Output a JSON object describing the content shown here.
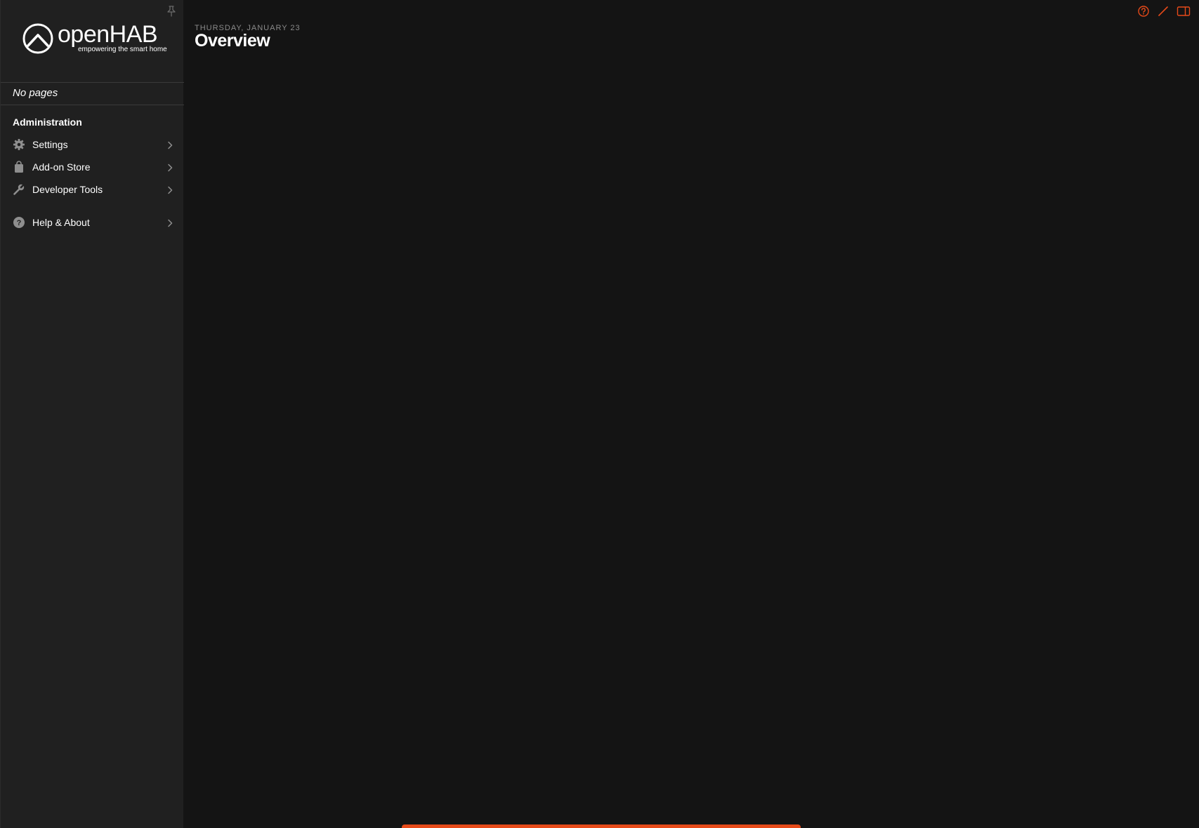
{
  "app": {
    "logo_text": "openHAB",
    "logo_tagline": "empowering the smart home"
  },
  "sidebar": {
    "no_pages_text": "No pages",
    "section_title": "Administration",
    "items": [
      {
        "label": "Settings",
        "icon": "gear-icon"
      },
      {
        "label": "Add-on Store",
        "icon": "bag-icon"
      },
      {
        "label": "Developer Tools",
        "icon": "wrench-icon"
      },
      {
        "label": "Help & About",
        "icon": "help-circle-icon"
      }
    ]
  },
  "header": {
    "date": "THURSDAY, JANUARY 23",
    "title": "Overview"
  },
  "toolbar": {
    "icons": [
      "help-icon",
      "edit-pencil-icon",
      "sidebar-toggle-icon"
    ]
  },
  "colors": {
    "accent": "#e64a19",
    "background": "#141414",
    "sidebar": "#202020",
    "icon_gray": "#8e8e8e"
  }
}
